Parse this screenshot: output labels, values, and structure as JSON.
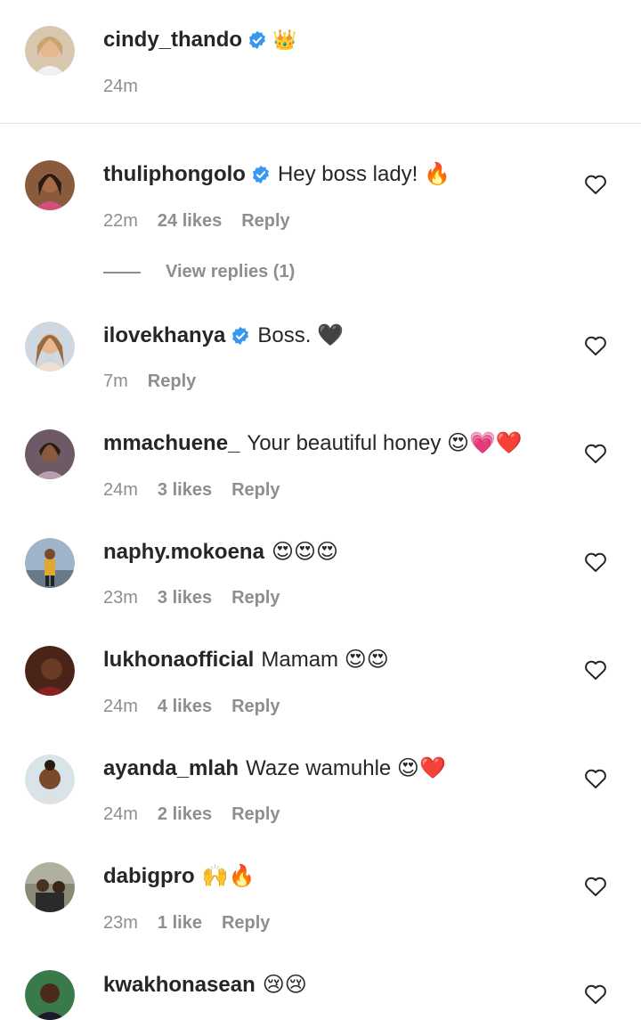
{
  "caption": {
    "username": "cindy_thando",
    "badge_emoji": "👑",
    "time": "24m"
  },
  "comments": [
    {
      "username": "thuliphongolo",
      "verified": true,
      "text": "Hey boss lady! 🔥",
      "time": "22m",
      "likes": "24 likes",
      "reply": "Reply"
    },
    {
      "username": "ilovekhanya",
      "verified": true,
      "text": "Boss. 🖤",
      "time": "7m",
      "likes": "",
      "reply": "Reply"
    },
    {
      "username": "mmachuene_",
      "verified": false,
      "text": "Your beautiful honey 😍💗❤️",
      "time": "24m",
      "likes": "3 likes",
      "reply": "Reply"
    },
    {
      "username": "naphy.mokoena",
      "verified": false,
      "text": "😍😍😍",
      "time": "23m",
      "likes": "3 likes",
      "reply": "Reply"
    },
    {
      "username": "lukhonaofficial",
      "verified": false,
      "text": "Mamam 😍😍",
      "time": "24m",
      "likes": "4 likes",
      "reply": "Reply"
    },
    {
      "username": "ayanda_mlah",
      "verified": false,
      "text": "Waze wamuhle 😍❤️",
      "time": "24m",
      "likes": "2 likes",
      "reply": "Reply"
    },
    {
      "username": "dabigpro",
      "verified": false,
      "text": "🙌🔥",
      "time": "23m",
      "likes": "1 like",
      "reply": "Reply"
    },
    {
      "username": "kwakhonasean",
      "verified": false,
      "text": "😢😢",
      "time": "",
      "likes": "",
      "reply": ""
    }
  ],
  "view_replies": "View replies (1)",
  "colors": {
    "verified": "#3897f0",
    "meta_text": "#8e8e8e",
    "primary_text": "#262626"
  },
  "icons": {
    "verified": "verified-badge-icon",
    "like": "heart-outline-icon"
  }
}
